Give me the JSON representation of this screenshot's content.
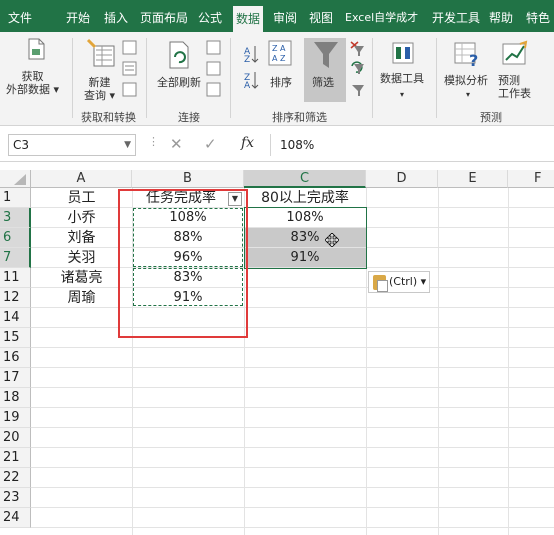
{
  "tabs": [
    "文件",
    "开始",
    "插入",
    "页面布局",
    "公式",
    "数据",
    "审阅",
    "视图",
    "Excel自学成才",
    "开发工具",
    "帮助",
    "特色"
  ],
  "active_tab": "数据",
  "ribbon": {
    "get_data": "获取\n外部数据 ▾",
    "new_query": "新建\n查询 ▾",
    "refresh_all": "全部刷新",
    "sort": "排序",
    "filter": "筛选",
    "data_tools": "数据工具",
    "what_if": "模拟分析",
    "forecast": "预测\n工作表",
    "group_get_transform": "获取和转换",
    "group_connections": "连接",
    "group_sort_filter": "排序和筛选",
    "group_forecast": "预测"
  },
  "formula_bar": {
    "name_box": "C3",
    "fx": "fx",
    "value": "108%"
  },
  "columns": [
    "A",
    "B",
    "C",
    "D",
    "E",
    "F"
  ],
  "rows": [
    "1",
    "3",
    "6",
    "7",
    "11",
    "12",
    "14",
    "15",
    "16",
    "17",
    "18",
    "19",
    "20",
    "21",
    "22",
    "23",
    "24"
  ],
  "cells": {
    "A1": "员工",
    "B1": "任务完成率",
    "C1": "80以上完成率",
    "A3": "小乔",
    "B3": "108%",
    "C3": "108%",
    "A6": "刘备",
    "B6": "88%",
    "C6": "83%",
    "A7": "关羽",
    "B7": "96%",
    "C7": "91%",
    "A11": "诸葛亮",
    "B11": "83%",
    "A12": "周瑜",
    "B12": "91%"
  },
  "paste_options": "(Ctrl) ▾",
  "colors": {
    "accent": "#217346",
    "highlight": "#e03a3a"
  }
}
